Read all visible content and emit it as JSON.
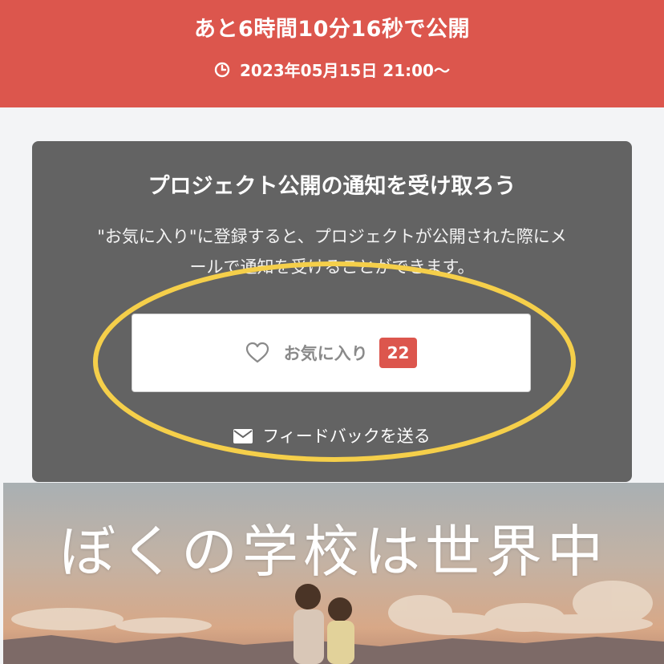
{
  "banner": {
    "countdown": "あと6時間10分16秒で公開",
    "release_datetime": "2023年05月15日 21:00〜",
    "icon": "clock-icon",
    "color": "#dc564d"
  },
  "notify_card": {
    "title": "プロジェクト公開の通知を受け取ろう",
    "description_line1": "\"お気に入り\"に登録すると、プロジェクトが公開された際にメ",
    "description_line2": "ールで通知を受けることができます。",
    "favorite_button": {
      "label": "お気に入り",
      "count": "22",
      "icon": "heart-outline-icon"
    },
    "feedback_link": {
      "label": "フィードバックを送る",
      "icon": "envelope-icon"
    }
  },
  "hero": {
    "title": "ぼくの学校は世界中"
  },
  "colors": {
    "accent": "#dc564d",
    "card_bg": "#636363",
    "highlight": "#f5cf4a"
  }
}
